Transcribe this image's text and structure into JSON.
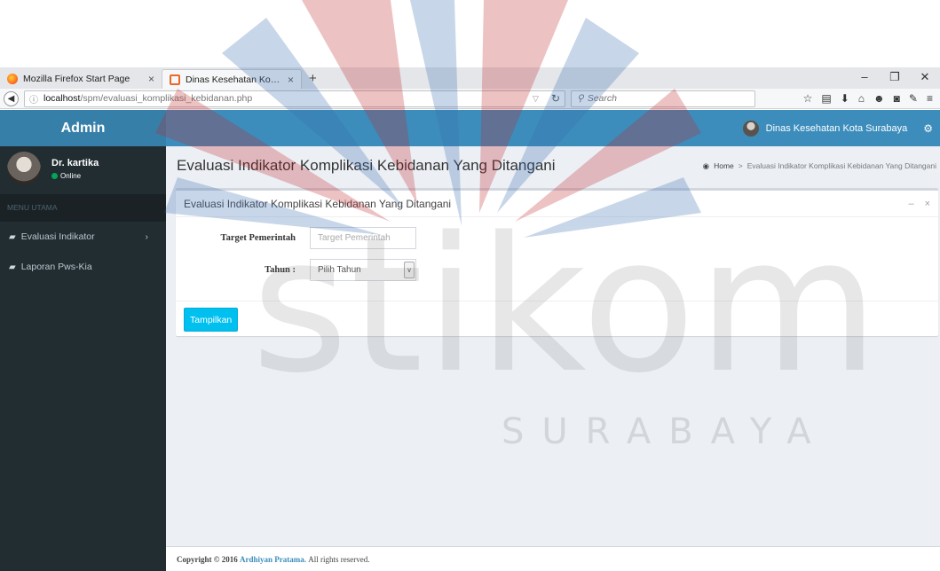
{
  "browser": {
    "tabs": [
      {
        "title": "Mozilla Firefox Start Page",
        "close": "×"
      },
      {
        "title": "Dinas Kesehatan Kota Sura...",
        "close": "×"
      }
    ],
    "new_tab": "+",
    "window_controls": [
      "–",
      "❐",
      "✕"
    ],
    "url_host": "localhost",
    "url_path": "/spm/evaluasi_komplikasi_kebidanan.php",
    "search_placeholder": "Search"
  },
  "header": {
    "logo": "Admin",
    "org_name": "Dinas Kesehatan Kota Surabaya"
  },
  "sidebar": {
    "user_name": "Dr. kartika",
    "user_status": "Online",
    "menu_header": "MENU UTAMA",
    "items": [
      {
        "label": "Evaluasi Indikator",
        "has_submenu": true
      },
      {
        "label": "Laporan Pws-Kia",
        "has_submenu": false
      }
    ]
  },
  "page": {
    "title": "Evaluasi Indikator Komplikasi Kebidanan Yang Ditangani",
    "breadcrumb_home": "Home",
    "breadcrumb_current": "Evaluasi Indikator Komplikasi Kebidanan Yang Ditangani",
    "box_title": "Evaluasi Indikator Komplikasi Kebidanan Yang Ditangani",
    "box_tools": [
      "–",
      "×"
    ],
    "form": {
      "target_label": "Target Pemerintah",
      "target_placeholder": "Target Pemerintah",
      "tahun_label": "Tahun :",
      "tahun_value": "Pilih Tahun"
    },
    "submit_label": "Tampilkan"
  },
  "footer": {
    "copyright": "Copyright © 2016",
    "author": "Ardhiyan Pratama.",
    "rights": "All rights reserved."
  },
  "watermark": {
    "word": "stikom",
    "sub": "SURABAYA"
  },
  "colors": {
    "header_blue": "#3c8dbc",
    "logo_blue": "#367fa9",
    "sidebar_dark": "#222d32",
    "content_bg": "#ecf0f5",
    "button_info": "#00c0ef",
    "online_green": "#00a65a"
  }
}
